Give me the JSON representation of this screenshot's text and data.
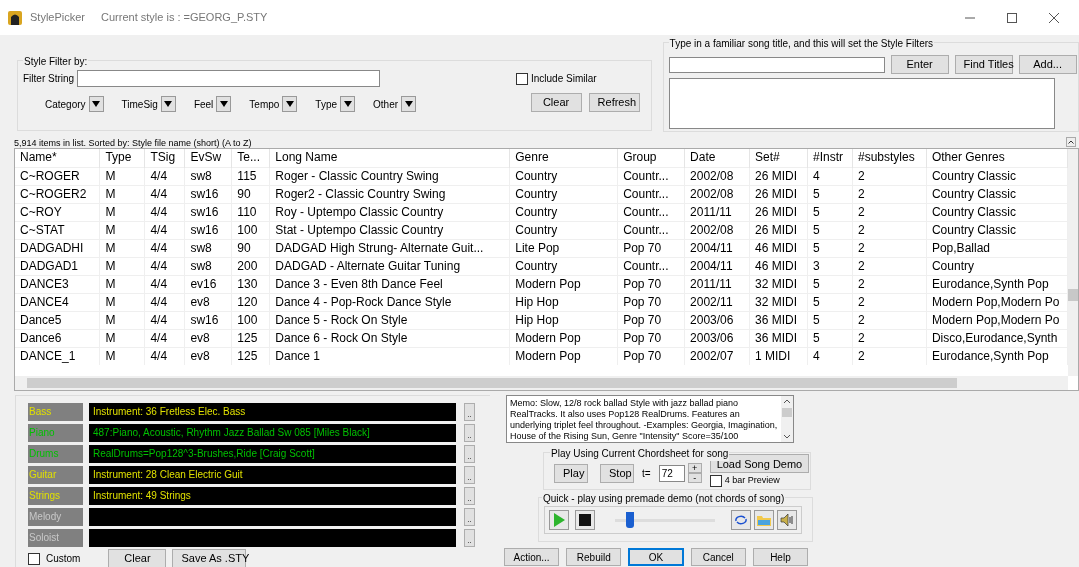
{
  "window": {
    "title": "StylePicker",
    "subtitle": "Current style is : =GEORG_P.STY"
  },
  "filter": {
    "legend": "Style Filter by:",
    "string_label": "Filter String",
    "include_similar": {
      "label": "Include Similar",
      "checked": false
    },
    "dropdowns": [
      "Category",
      "TimeSig",
      "Feel",
      "Tempo",
      "Type",
      "Other"
    ],
    "buttons": [
      "Clear",
      "Refresh"
    ]
  },
  "song_title": {
    "legend": "Type in a familiar song title, and this will set the Style Filters",
    "buttons": [
      "Enter",
      "Find Titles",
      "Add..."
    ]
  },
  "status": "5,914 items in list. Sorted by: Style file name (short)  (A to Z)",
  "table": {
    "columns": [
      "Name*",
      "Type",
      "TSig",
      "EvSw",
      "Te...",
      "Long Name",
      "Genre",
      "Group",
      "Date",
      "Set#",
      "#Instr",
      "#substyles",
      "Other Genres"
    ],
    "rows": [
      [
        "C~ROGER",
        "M",
        "4/4",
        "sw8",
        "115",
        "Roger - Classic Country Swing",
        "Country",
        "Countr...",
        "2002/08",
        "26 MIDI",
        "4",
        "2",
        "Country Classic"
      ],
      [
        "C~ROGER2",
        "M",
        "4/4",
        "sw16",
        "90",
        "Roger2 - Classic Country Swing",
        "Country",
        "Countr...",
        "2002/08",
        "26 MIDI",
        "5",
        "2",
        "Country Classic"
      ],
      [
        "C~ROY",
        "M",
        "4/4",
        "sw16",
        "110",
        "Roy - Uptempo Classic Country",
        "Country",
        "Countr...",
        "2011/11",
        "26 MIDI",
        "5",
        "2",
        "Country Classic"
      ],
      [
        "C~STAT",
        "M",
        "4/4",
        "sw16",
        "100",
        "Stat - Uptempo Classic Country",
        "Country",
        "Countr...",
        "2002/08",
        "26 MIDI",
        "5",
        "2",
        "Country Classic"
      ],
      [
        "DADGADHI",
        "M",
        "4/4",
        "sw8",
        "90",
        "DADGAD High Strung- Alternate Guit...",
        "Lite Pop",
        "Pop 70",
        "2004/11",
        "46 MIDI",
        "5",
        "2",
        "Pop,Ballad"
      ],
      [
        "DADGAD1",
        "M",
        "4/4",
        "sw8",
        "200",
        "DADGAD - Alternate Guitar Tuning",
        "Country",
        "Countr...",
        "2004/11",
        "46 MIDI",
        "3",
        "2",
        "Country"
      ],
      [
        "DANCE3",
        "M",
        "4/4",
        "ev16",
        "130",
        "Dance 3 - Even 8th Dance Feel",
        "Modern Pop",
        "Pop 70",
        "2011/11",
        "32 MIDI",
        "5",
        "2",
        "Eurodance,Synth Pop"
      ],
      [
        "DANCE4",
        "M",
        "4/4",
        "ev8",
        "120",
        "Dance 4 - Pop-Rock Dance Style",
        "Hip Hop",
        "Pop 70",
        "2002/11",
        "32 MIDI",
        "5",
        "2",
        "Modern Pop,Modern Po"
      ],
      [
        "Dance5",
        "M",
        "4/4",
        "sw16",
        "100",
        "Dance 5 - Rock On Style",
        "Hip Hop",
        "Pop 70",
        "2003/06",
        "36 MIDI",
        "5",
        "2",
        "Modern Pop,Modern Po"
      ],
      [
        "Dance6",
        "M",
        "4/4",
        "ev8",
        "125",
        "Dance 6 - Rock On Style",
        "Modern Pop",
        "Pop 70",
        "2003/06",
        "36 MIDI",
        "5",
        "2",
        "Disco,Eurodance,Synth"
      ],
      [
        "DANCE_1",
        "M",
        "4/4",
        "ev8",
        "125",
        "Dance 1",
        "Modern Pop",
        "Pop 70",
        "2002/07",
        "1 MIDI",
        "4",
        "2",
        "Eurodance,Synth Pop"
      ]
    ]
  },
  "tracks": [
    {
      "label": "Bass",
      "value": "Instrument: 36 Fretless Elec. Bass",
      "kind": "midi",
      "button": ".."
    },
    {
      "label": "Piano",
      "value": "487:Piano, Acoustic, Rhythm Jazz Ballad Sw 085 [Miles Black]",
      "kind": "realtracks",
      "button": ".."
    },
    {
      "label": "Drums",
      "value": "RealDrums=Pop128^3-Brushes,Ride [Craig Scott]",
      "kind": "realtracks",
      "button": ".."
    },
    {
      "label": "Guitar",
      "value": "Instrument: 28 Clean Electric Guit",
      "kind": "midi",
      "button": ".."
    },
    {
      "label": "Strings",
      "value": "Instrument: 49 Strings",
      "kind": "midi",
      "button": ".."
    },
    {
      "label": "Melody",
      "kind": "empty",
      "button": ".."
    },
    {
      "label": "Soloist",
      "kind": "empty",
      "button": ".."
    }
  ],
  "track_footer": {
    "custom": {
      "label": "Custom",
      "checked": false
    },
    "buttons": [
      "Clear",
      "Save As .STY"
    ]
  },
  "memo": "Memo: Slow, 12/8 rock ballad Style with jazz ballad piano RealTracks. It also uses Pop128 RealDrums. Features an underlying triplet feel throughout. -Examples: Georgia, Imagination, House of the Rising Sun, Genre \"Intensity\" Score=35/100",
  "chordsheet": {
    "legend": "Play Using Current Chordsheet for song",
    "play": "Play",
    "stop": "Stop",
    "tempo_label": "t=",
    "tempo": "72",
    "plus": "+",
    "minus": "-",
    "load_demo": "Load Song Demo",
    "preview": {
      "label": "4 bar Preview",
      "checked": false
    }
  },
  "quick": {
    "legend": "Quick - play using premade demo (not chords of song)",
    "level": 0.15
  },
  "actions": [
    {
      "label": "Action...",
      "default": false
    },
    {
      "label": "Rebuild",
      "default": false
    },
    {
      "label": "OK",
      "default": true
    },
    {
      "label": "Cancel",
      "default": false
    },
    {
      "label": "Help",
      "default": false
    }
  ]
}
